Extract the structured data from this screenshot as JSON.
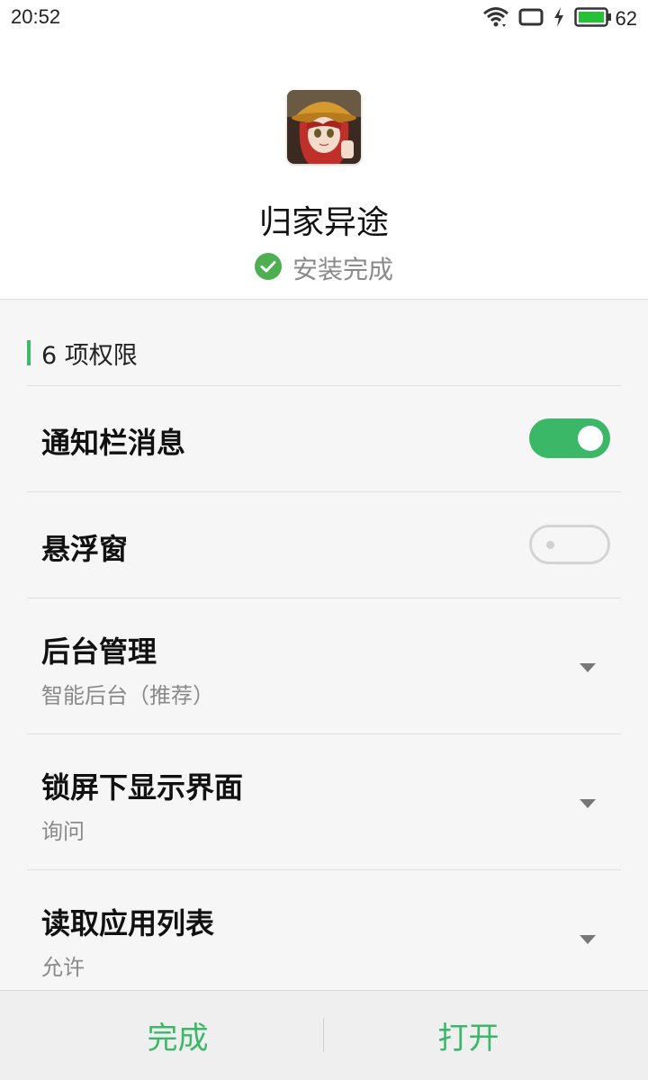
{
  "status_bar": {
    "time": "20:52",
    "battery_level": "62",
    "icons": [
      "wifi-icon",
      "screen-rotation-icon",
      "charging-icon",
      "battery-icon"
    ]
  },
  "app": {
    "name": "归家异途",
    "install_status": "安装完成",
    "status_icon": "check-circle-icon"
  },
  "permissions": {
    "section_title": "6 项权限",
    "items": [
      {
        "title": "通知栏消息",
        "control": "toggle",
        "enabled": true
      },
      {
        "title": "悬浮窗",
        "control": "toggle",
        "enabled": false
      },
      {
        "title": "后台管理",
        "control": "dropdown",
        "value": "智能后台（推荐）"
      },
      {
        "title": "锁屏下显示界面",
        "control": "dropdown",
        "value": "询问"
      },
      {
        "title": "读取应用列表",
        "control": "dropdown",
        "value": "允许"
      }
    ]
  },
  "bottom_bar": {
    "done_label": "完成",
    "open_label": "打开"
  },
  "colors": {
    "accent": "#3ab867",
    "panel_bg": "#f6f6f6",
    "subtext": "#8a8a8a"
  }
}
